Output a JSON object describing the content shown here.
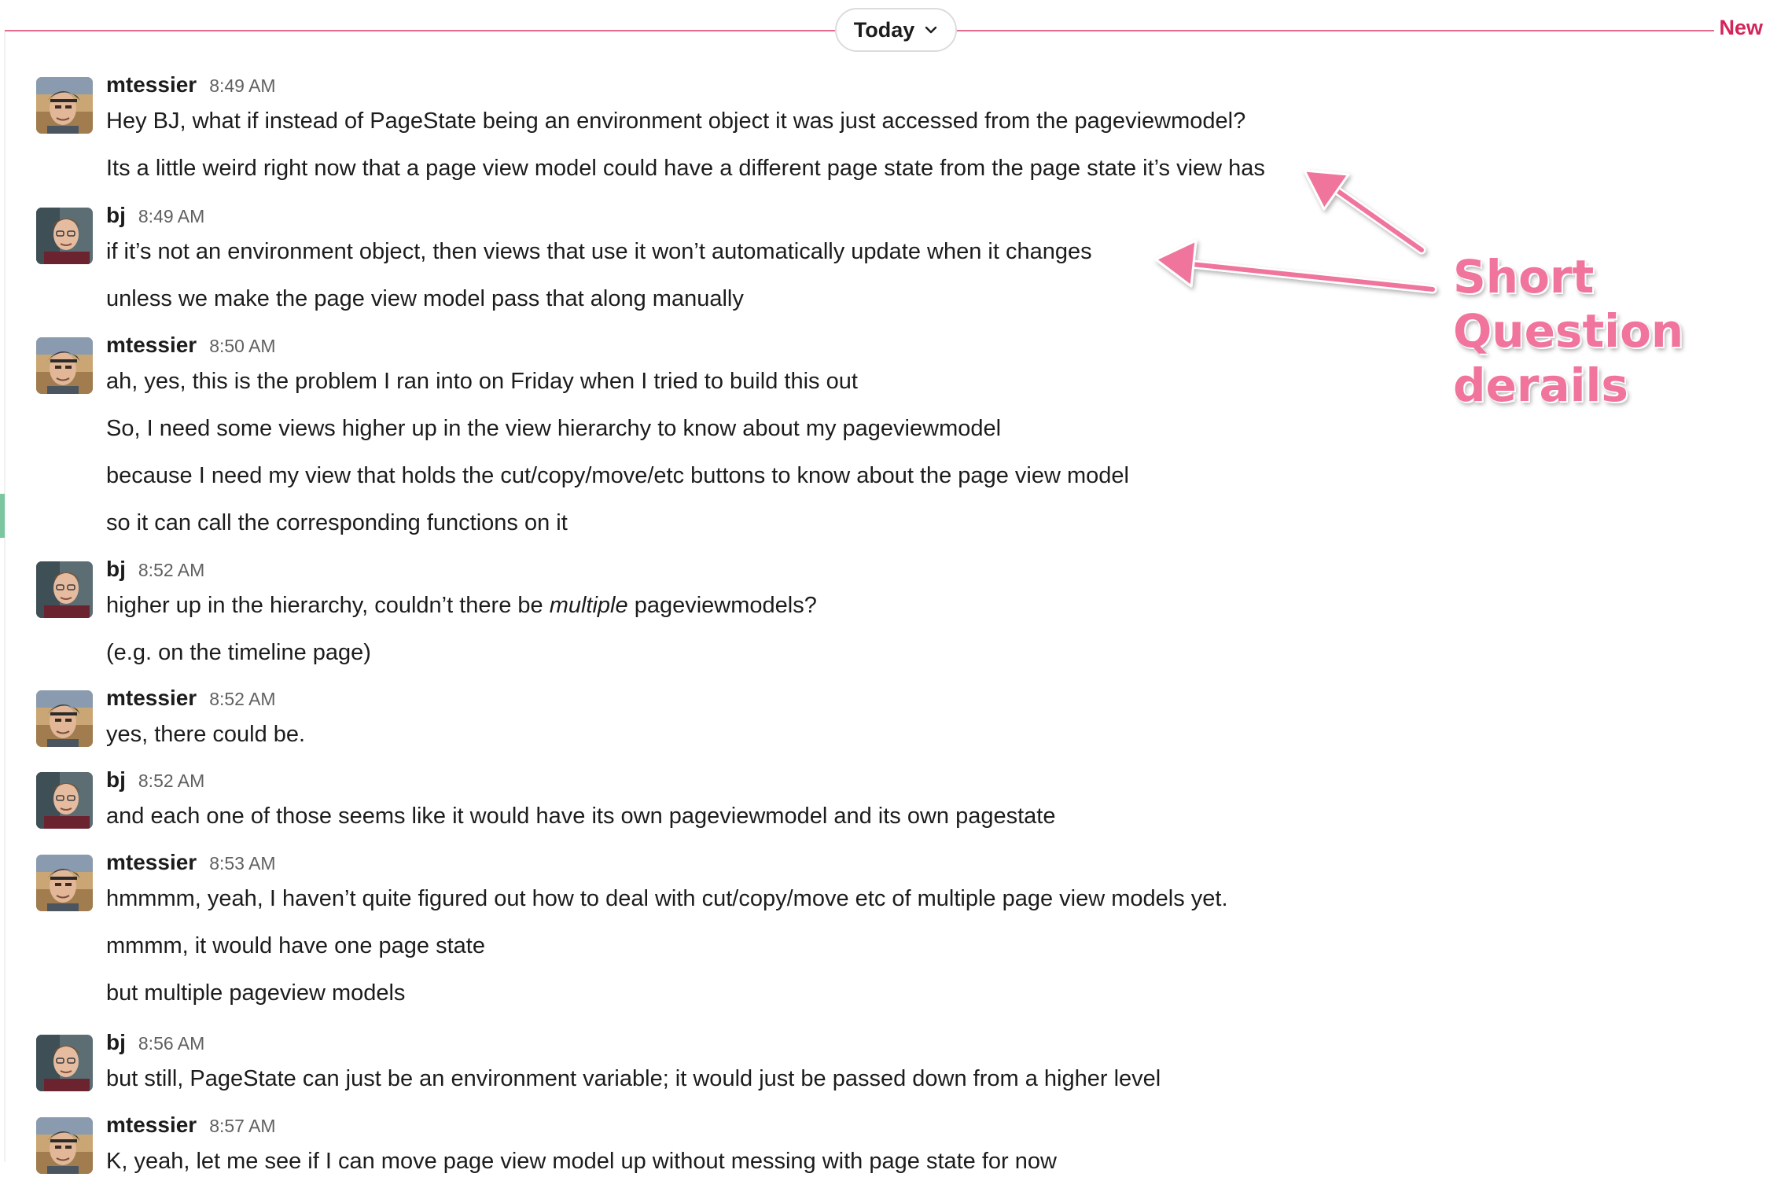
{
  "divider": {
    "date_label": "Today",
    "new_label": "New"
  },
  "colors": {
    "accent": "#e36b8e",
    "new": "#d3255a",
    "annotation": "#f0749c",
    "left_accent": "#7cc6a0"
  },
  "annotation": {
    "lines": [
      "Short",
      "Question",
      "derails"
    ]
  },
  "messages": [
    {
      "author": "mtessier",
      "time": "8:49 AM",
      "avatar": "avatar-mtessier",
      "lines": [
        "Hey BJ, what if instead of PageState being an environment object it was just accessed from the pageviewmodel?",
        "Its a little weird right now that a page view model could have a different page state from the page state it’s view has"
      ]
    },
    {
      "author": "bj",
      "time": "8:49 AM",
      "avatar": "avatar-bj",
      "lines": [
        "if it’s not an environment object, then views that use it won’t automatically update when it changes",
        "unless we make the page view model pass that along manually"
      ]
    },
    {
      "author": "mtessier",
      "time": "8:50 AM",
      "avatar": "avatar-mtessier",
      "lines": [
        "ah, yes, this is the problem I ran into on Friday when I tried to build this out",
        "So, I need some views higher up in the view hierarchy to know about my pageviewmodel",
        "because I need my view that holds the cut/copy/move/etc buttons to know about the page view model",
        "so it can call the corresponding functions on it"
      ]
    },
    {
      "author": "bj",
      "time": "8:52 AM",
      "avatar": "avatar-bj",
      "lines": [
        {
          "pre": "higher up in the hierarchy, couldn’t there be ",
          "em": "multiple",
          "post": " pageviewmodels?"
        },
        "(e.g. on the timeline page)"
      ]
    },
    {
      "author": "mtessier",
      "time": "8:52 AM",
      "avatar": "avatar-mtessier",
      "lines": [
        "yes, there could be."
      ]
    },
    {
      "author": "bj",
      "time": "8:52 AM",
      "avatar": "avatar-bj",
      "lines": [
        "and each one of those seems like it would have its own pageviewmodel and its own pagestate"
      ]
    },
    {
      "author": "mtessier",
      "time": "8:53 AM",
      "avatar": "avatar-mtessier",
      "lines": [
        "hmmmm, yeah, I haven’t quite figured out how to deal with cut/copy/move etc of multiple page view models yet.",
        "mmmm, it would have one page state",
        "but multiple pageview models"
      ]
    },
    {
      "author": "bj",
      "time": "8:56 AM",
      "avatar": "avatar-bj",
      "lines": [
        "but still, PageState can just be an environment variable; it would just be passed down from a higher level"
      ]
    },
    {
      "author": "mtessier",
      "time": "8:57 AM",
      "avatar": "avatar-mtessier",
      "lines": [
        "K, yeah, let me see if I can move page view model up without messing with page state for now"
      ]
    }
  ]
}
